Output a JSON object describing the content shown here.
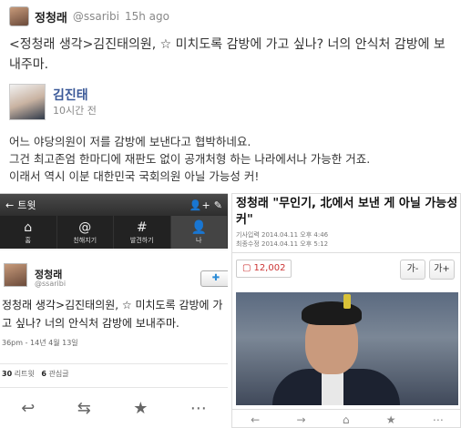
{
  "tweet": {
    "name": "정청래",
    "handle": "@ssaribi",
    "time": "15h ago",
    "text": "<정청래 생각>김진태의원, ☆ 미치도록 감방에 가고 싶나? 너의 안식처 감방에 보내주마."
  },
  "fb_post": {
    "name": "김진태",
    "time": "10시간 전",
    "lines": [
      "어느 야당의원이 저를 감방에 보낸다고 협박하네요.",
      "그건 최고존엄 한마디에 재판도 없이 공개처형 하는 나라에서나 가능한 거죠.",
      "이래서 역시 이분 대한민국 국회의원 아닐 가능성 커!"
    ]
  },
  "left_screenshot": {
    "topbar_title": "트윗",
    "tabs": [
      {
        "icon": "⌂",
        "label": "홈"
      },
      {
        "icon": "@",
        "label": "친해지기"
      },
      {
        "icon": "#",
        "label": "발견하기"
      },
      {
        "icon": "👤",
        "label": "나"
      }
    ],
    "tweet_name": "정청래",
    "tweet_handle": "@ssaribi",
    "follow_label": "✚",
    "tweet_text": "정청래 생각>김진태의원, ☆ 미치도록 감방에 가고 싶나? 너의 안식처 감방에 보내주마.",
    "meta": "36pm - 14년 4월 13일",
    "stats": {
      "retweets": "30",
      "retweets_label": "리트윗",
      "favs": "6",
      "favs_label": "관심글"
    },
    "actions": [
      "↩",
      "⇆",
      "★",
      "⋯"
    ]
  },
  "right_screenshot": {
    "title": "정청래 \"무인기, 北에서 보낸 게 아닐 가능성 커\"",
    "meta_line1": "기사입력 2014.04.11 오후 4:46",
    "meta_line2": "최종수정 2014.04.11 오후 5:12",
    "count": "12,002",
    "font_small": "가-",
    "font_large": "가+",
    "nav": [
      "←",
      "→",
      "⌂",
      "★",
      "⋯"
    ]
  }
}
